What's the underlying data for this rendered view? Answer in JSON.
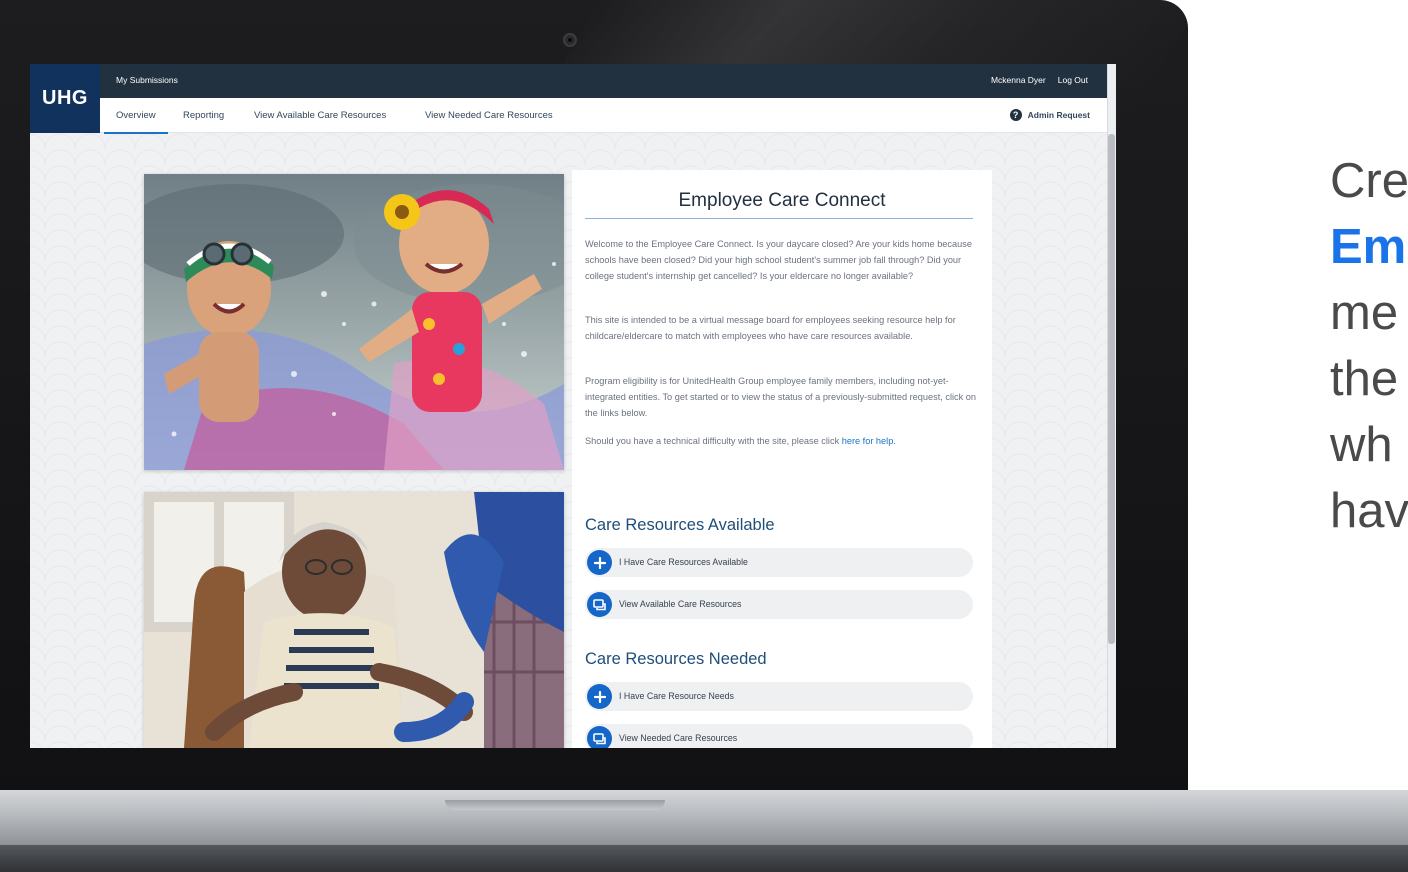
{
  "app": {
    "logo": "UHG",
    "top_link": "My Submissions",
    "user_name": "Mckenna Dyer",
    "logout": "Log Out",
    "admin_request": "Admin Request"
  },
  "nav": {
    "items": [
      "Overview",
      "Reporting",
      "View Available Care Resources",
      "View Needed Care Resources"
    ],
    "active": "Overview"
  },
  "panel": {
    "title": "Employee Care Connect",
    "paragraphs": [
      "Welcome to the Employee Care Connect. Is your daycare closed? Are your kids home because schools have been closed? Did your high school student's summer job fall through? Did your college student's internship get cancelled? Is your eldercare no longer available?",
      "This site is intended to be a virtual message board for employees seeking resource help for childcare/eldercare to match with employees who have care resources available.",
      "Program eligibility is for UnitedHealth Group employee family members, including not-yet-integrated entities. To get started or to view the status of a previously-submitted request, click on the links below."
    ],
    "help_prefix": "Should you have a technical difficulty with the site, please click ",
    "help_link": "here for help."
  },
  "sections": {
    "available_title": "Care Resources Available",
    "available_actions": [
      "I Have Care Resources Available",
      "View Available Care Resources"
    ],
    "needed_title": "Care Resources Needed",
    "needed_actions": [
      "I Have Care Resource Needs",
      "View Needed Care Resources"
    ]
  },
  "side_text": {
    "line1": "Cre",
    "line2": "Em",
    "line3": "me",
    "line4": "the",
    "line5": "wh",
    "line6": "hav"
  },
  "colors": {
    "topbar": "#223140",
    "logo_bg": "#10325c",
    "accent": "#1466c9",
    "section_title": "#1f4e79",
    "side_highlight": "#1a73e8"
  },
  "icons": {
    "help": "question-circle-icon",
    "add": "plus-icon",
    "view": "chat-bubbles-icon"
  }
}
